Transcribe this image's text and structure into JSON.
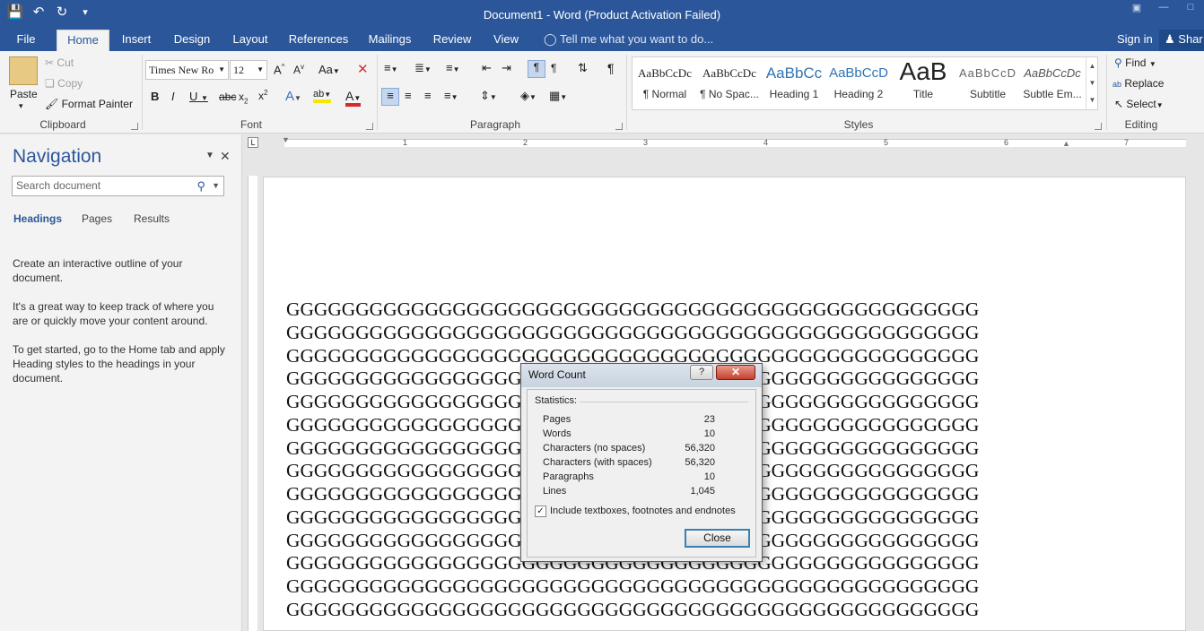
{
  "titlebar": {
    "title": "Document1 - Word (Product Activation Failed)"
  },
  "tabs": {
    "file": "File",
    "home": "Home",
    "insert": "Insert",
    "design": "Design",
    "layout": "Layout",
    "references": "References",
    "mailings": "Mailings",
    "review": "Review",
    "view": "View",
    "tellme": "Tell me what you want to do...",
    "signin": "Sign in",
    "share": "Shar"
  },
  "clipboard": {
    "paste": "Paste",
    "cut": "Cut",
    "copy": "Copy",
    "format_painter": "Format Painter",
    "label": "Clipboard"
  },
  "font": {
    "name": "Times New Ro",
    "size": "12",
    "label": "Font"
  },
  "paragraph": {
    "label": "Paragraph"
  },
  "styles": {
    "label": "Styles",
    "items": [
      {
        "preview": "AaBbCcDc",
        "name": "¶ Normal"
      },
      {
        "preview": "AaBbCcDc",
        "name": "¶ No Spac..."
      },
      {
        "preview": "AaBbCc",
        "name": "Heading 1"
      },
      {
        "preview": "AaBbCcD",
        "name": "Heading 2"
      },
      {
        "preview": "AaB",
        "name": "Title"
      },
      {
        "preview": "AaBbCcD",
        "name": "Subtitle"
      },
      {
        "preview": "AaBbCcDc",
        "name": "Subtle Em..."
      }
    ]
  },
  "editing": {
    "find": "Find",
    "replace": "Replace",
    "select": "Select",
    "label": "Editing"
  },
  "ruler": {
    "numbers": [
      "1",
      "2",
      "3",
      "4",
      "5",
      "6",
      "7"
    ]
  },
  "navigation": {
    "title": "Navigation",
    "search_placeholder": "Search document",
    "tabs": {
      "headings": "Headings",
      "pages": "Pages",
      "results": "Results"
    },
    "para1": "Create an interactive outline of your document.",
    "para2": "It's a great way to keep track of where you are or quickly move your content around.",
    "para3": "To get started, go to the Home tab and apply Heading styles to the headings in your document."
  },
  "document": {
    "line_text": "GGGGGGGGGGGGGGGGGGGGGGGGGGGGGGGGGGGGGGGGGGGGGGGGGG",
    "line_count": 14
  },
  "dialog": {
    "title": "Word Count",
    "help": "?",
    "statistics_label": "Statistics:",
    "stats": [
      {
        "label": "Pages",
        "value": "23"
      },
      {
        "label": "Words",
        "value": "10"
      },
      {
        "label": "Characters (no spaces)",
        "value": "56,320"
      },
      {
        "label": "Characters (with spaces)",
        "value": "56,320"
      },
      {
        "label": "Paragraphs",
        "value": "10"
      },
      {
        "label": "Lines",
        "value": "1,045"
      }
    ],
    "include_label": "Include textboxes, footnotes and endnotes",
    "include_checked": true,
    "close": "Close"
  }
}
